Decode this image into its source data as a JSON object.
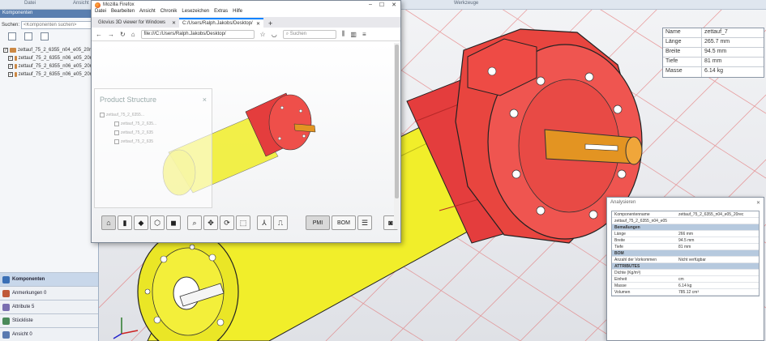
{
  "ribbon": {
    "items": [
      "Datei",
      "Ansicht",
      "Werkzeuge"
    ]
  },
  "left_panel": {
    "title": "Komponenten",
    "search_label": "Suchen:",
    "search_placeholder": "<Komponenten suchen>",
    "tree": [
      {
        "label": "zettauf_75_2_6355_n04_e05_20rec",
        "checked": true
      },
      {
        "label": "zettauf_75_2_6355_n06_e05_20rec",
        "checked": true
      },
      {
        "label": "zettauf_75_2_6355_n06_e05_20rec",
        "checked": true
      },
      {
        "label": "zettauf_75_2_6355_n06_e05_20rec",
        "checked": true
      }
    ],
    "tabs": [
      {
        "label": "Komponenten",
        "icon": "components-icon",
        "active": true
      },
      {
        "label": "Anmerkungen 0",
        "icon": "annotations-icon",
        "active": false
      },
      {
        "label": "Attribute 5",
        "icon": "attributes-icon",
        "active": false
      },
      {
        "label": "Stückliste",
        "icon": "bom-icon",
        "active": false
      },
      {
        "label": "Ansicht 0",
        "icon": "views-icon",
        "active": false
      }
    ]
  },
  "properties": [
    {
      "key": "Name",
      "value": "zettauf_7"
    },
    {
      "key": "Länge",
      "value": "265.7 mm"
    },
    {
      "key": "Breite",
      "value": "94.5 mm"
    },
    {
      "key": "Tiefe",
      "value": "81 mm"
    },
    {
      "key": "Masse",
      "value": "6.14 kg"
    }
  ],
  "analysis": {
    "title": "Analysieren",
    "rows": [
      {
        "k": "Komponentenname",
        "v": "zettauf_75_2_6355_n04_e05_20rec",
        "type": ""
      },
      {
        "k": "zettauf_75_2_6355_n04_e05",
        "v": "",
        "type": "full"
      },
      {
        "k": "Bemaßungen",
        "v": "",
        "type": "head"
      },
      {
        "k": "Länge",
        "v": "266 mm",
        "type": ""
      },
      {
        "k": "Breite",
        "v": "94.5 mm",
        "type": ""
      },
      {
        "k": "Tiefe",
        "v": "81 mm",
        "type": ""
      },
      {
        "k": "BOM",
        "v": "",
        "type": "head"
      },
      {
        "k": "Anzahl der Vorkommen",
        "v": "Nicht verfügbar",
        "type": ""
      },
      {
        "k": "ATTRIBUTES",
        "v": "",
        "type": "head"
      },
      {
        "k": "Dichte (Kg/m³)",
        "v": "",
        "type": ""
      },
      {
        "k": "Einheit",
        "v": "cm",
        "type": ""
      },
      {
        "k": "Masse",
        "v": "6.14 kg",
        "type": ""
      },
      {
        "k": "Volumen",
        "v": "785.12 cm³",
        "type": ""
      }
    ]
  },
  "firefox": {
    "title": "Mozilla Firefox",
    "menu": [
      "Datei",
      "Bearbeiten",
      "Ansicht",
      "Chronik",
      "Lesezeichen",
      "Extras",
      "Hilfe"
    ],
    "tabs": [
      {
        "label": "Glovius 3D viewer for Windows",
        "active": false
      },
      {
        "label": "C:/Users/Ralph.Jakobs/Desktop/",
        "active": true
      }
    ],
    "url": "file:///C:/Users/Ralph.Jakobs/Desktop/",
    "search_placeholder": "Suchen",
    "product_structure": {
      "title": "Product Structure",
      "items": [
        "zettauf_75_2_6355...",
        "zettauf_75_2_635...",
        "zettauf_75_2_635",
        "zettauf_75_2_635"
      ]
    },
    "toolbar": [
      "⌂",
      "▮",
      "◆",
      "⬡",
      "◼",
      "⌕",
      "✥",
      "⟳",
      "⬚",
      "⅄",
      "⎍"
    ],
    "toolbar_wide": [
      "PMI",
      "BOM"
    ]
  }
}
